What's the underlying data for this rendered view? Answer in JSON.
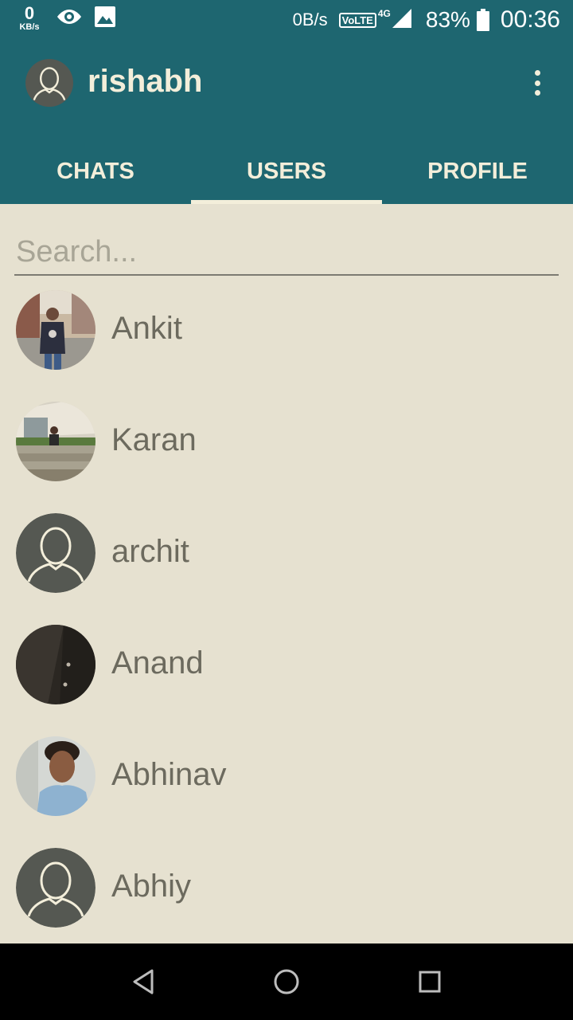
{
  "status_bar": {
    "kbs_value": "0",
    "kbs_unit": "KB/s",
    "net_speed": "0B/s",
    "volte": "VoLTE",
    "network": "4G",
    "battery": "83%",
    "time": "00:36",
    "icons": [
      "eye-icon",
      "image-icon",
      "signal-icon",
      "battery-icon"
    ]
  },
  "app_bar": {
    "title": "rishabh",
    "color": "#1e6670",
    "text_color": "#f3eeda",
    "icons": [
      "avatar-icon",
      "more-vert-icon"
    ]
  },
  "tabs": [
    {
      "label": "CHATS",
      "active": false
    },
    {
      "label": "USERS",
      "active": true
    },
    {
      "label": "PROFILE",
      "active": false
    }
  ],
  "search": {
    "placeholder": "Search...",
    "value": ""
  },
  "users": [
    {
      "name": "Ankit",
      "avatar": "photo"
    },
    {
      "name": "Karan",
      "avatar": "photo"
    },
    {
      "name": "archit",
      "avatar": "default"
    },
    {
      "name": "Anand",
      "avatar": "photo"
    },
    {
      "name": "Abhinav",
      "avatar": "photo"
    },
    {
      "name": "Abhiy",
      "avatar": "default"
    }
  ],
  "nav_bar": {
    "icons": [
      "back-icon",
      "home-icon",
      "recents-icon"
    ]
  },
  "colors": {
    "background": "#e6e1d0",
    "primary": "#1e6670",
    "avatar_default": "#555852"
  }
}
